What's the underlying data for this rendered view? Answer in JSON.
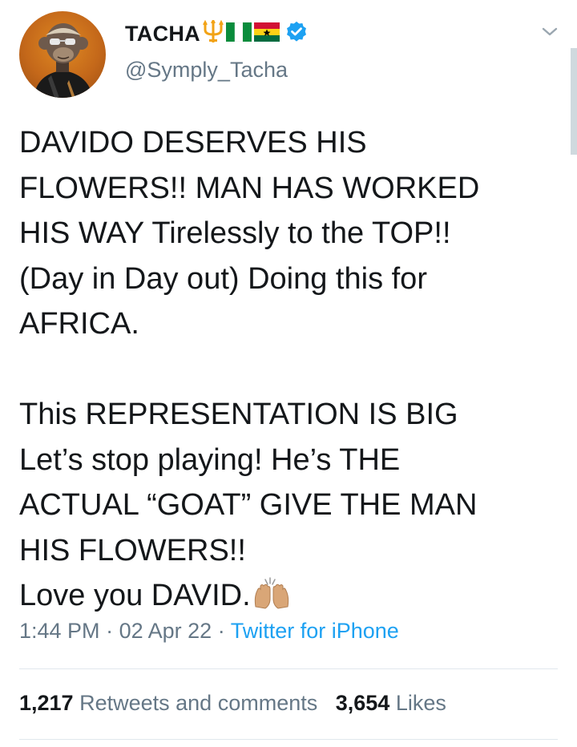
{
  "tweet": {
    "display_name": "TACHA",
    "name_emojis": [
      "trident-emoji",
      "nigeria-flag-emoji",
      "ghana-flag-emoji"
    ],
    "verified": true,
    "handle": "@Symply_Tacha",
    "body_lines": [
      "DAVIDO DESERVES HIS",
      "FLOWERS!! MAN HAS WORKED",
      "HIS WAY Tirelessly to the TOP!!",
      "(Day in Day out) Doing this for",
      "AFRICA.",
      "",
      "This REPRESENTATION IS BIG",
      "Let’s stop playing! He’s THE",
      "ACTUAL “GOAT” GIVE THE MAN",
      "HIS FLOWERS!!",
      "Love you DAVID."
    ],
    "body_end_emoji": "raising-hands-emoji",
    "time": "1:44 PM",
    "date": "02 Apr 22",
    "separator": "·",
    "source": "Twitter for iPhone",
    "retweets_count": "1,217",
    "retweets_label": "Retweets and comments",
    "likes_count": "3,654",
    "likes_label": "Likes"
  },
  "colors": {
    "text": "#14171a",
    "secondary": "#657786",
    "link": "#1da1f2",
    "verified": "#1da1f2",
    "divider": "#e1e8ed"
  }
}
